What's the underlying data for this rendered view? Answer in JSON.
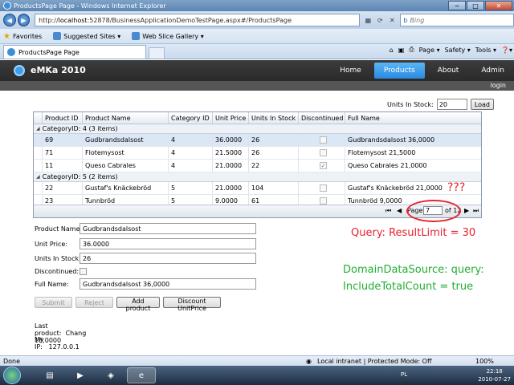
{
  "window": {
    "title": "ProductsPage Page - Windows Internet Explorer",
    "minimize": "─",
    "maximize": "□",
    "close": "✕"
  },
  "browser": {
    "back": "◀",
    "forward": "▶",
    "url_prefix": "http://",
    "url_host": "localhost",
    "url_rest": ":52878/BusinessApplicationDemoTestPage.aspx#/ProductsPage",
    "search_placeholder": "Bing",
    "favorites_label": "Favorites",
    "suggested_sites": "Suggested Sites ▾",
    "web_slice_gallery": "Web Slice Gallery ▾",
    "tab_title": "ProductsPage Page",
    "cmd": {
      "page": "Page ▾",
      "safety": "Safety ▾",
      "tools": "Tools ▾",
      "help": "❓▾"
    }
  },
  "app": {
    "brand": "eMKa 2010",
    "nav": [
      {
        "label": "Home"
      },
      {
        "label": "Products"
      },
      {
        "label": "About"
      },
      {
        "label": "Admin"
      }
    ],
    "login": "login"
  },
  "filter": {
    "label": "Units In Stock:",
    "value": "20",
    "button": "Load"
  },
  "grid": {
    "columns": [
      "Product ID",
      "Product Name",
      "Category ID",
      "Unit Price",
      "Units In Stock",
      "Discontinued",
      "Full Name"
    ],
    "sort_indicator": "▾",
    "groups": [
      {
        "label": "CategoryID: 4 (3 items)",
        "rows": [
          {
            "id": "69",
            "name": "Gudbrandsdalsost",
            "cat": "4",
            "price": "36.0000",
            "stock": "26",
            "disc": false,
            "full": "Gudbrandsdalsost 36,0000"
          },
          {
            "id": "71",
            "name": "Flotemysost",
            "cat": "4",
            "price": "21.5000",
            "stock": "26",
            "disc": false,
            "full": "Flotemysost 21,5000"
          },
          {
            "id": "11",
            "name": "Queso Cabrales",
            "cat": "4",
            "price": "21.0000",
            "stock": "22",
            "disc": true,
            "full": "Queso Cabrales 21,0000"
          }
        ]
      },
      {
        "label": "CategoryID: 5 (2 items)",
        "rows": [
          {
            "id": "22",
            "name": "Gustaf's Knäckebröd",
            "cat": "5",
            "price": "21.0000",
            "stock": "104",
            "disc": false,
            "full": "Gustaf's Knäckebröd 21,0000"
          },
          {
            "id": "23",
            "name": "Tunnbröd",
            "cat": "5",
            "price": "9.0000",
            "stock": "61",
            "disc": false,
            "full": "Tunnbröd 9,0000"
          }
        ]
      }
    ],
    "pager": {
      "first": "⏮",
      "prev": "◀",
      "page_label": "Page",
      "page_value": "7",
      "of_label": "of 12",
      "next": "▶",
      "last": "⏭"
    }
  },
  "annotations": {
    "question": "???",
    "query_limit": "Query: ResultLimit = 30",
    "dds_line1": "DomainDataSource: query:",
    "dds_line2": "IncludeTotalCount = true"
  },
  "form": {
    "product_name_label": "Product Name:",
    "product_name_value": "Gudbrandsdalsost",
    "unit_price_label": "Unit Price:",
    "unit_price_value": "36.0000",
    "units_in_stock_label": "Units In Stock:",
    "units_in_stock_value": "26",
    "discontinued_label": "Discontinued:",
    "full_name_label": "Full Name:",
    "full_name_value": "Gudbrandsdalsost 36,0000",
    "submit": "Submit",
    "reject": "Reject",
    "add_product": "Add product",
    "discount": "Discount UnitPrice",
    "last_product_label": "Last product:",
    "last_product_value": "Chang 18,0000",
    "my_ip_label": "My IP:",
    "my_ip_value": "127.0.0.1"
  },
  "status": {
    "done": "Done",
    "zone": "Local intranet | Protected Mode: Off",
    "zoom": "100%"
  },
  "taskbar": {
    "lang": "PL",
    "time": "22:18",
    "date": "2010-07-27"
  }
}
